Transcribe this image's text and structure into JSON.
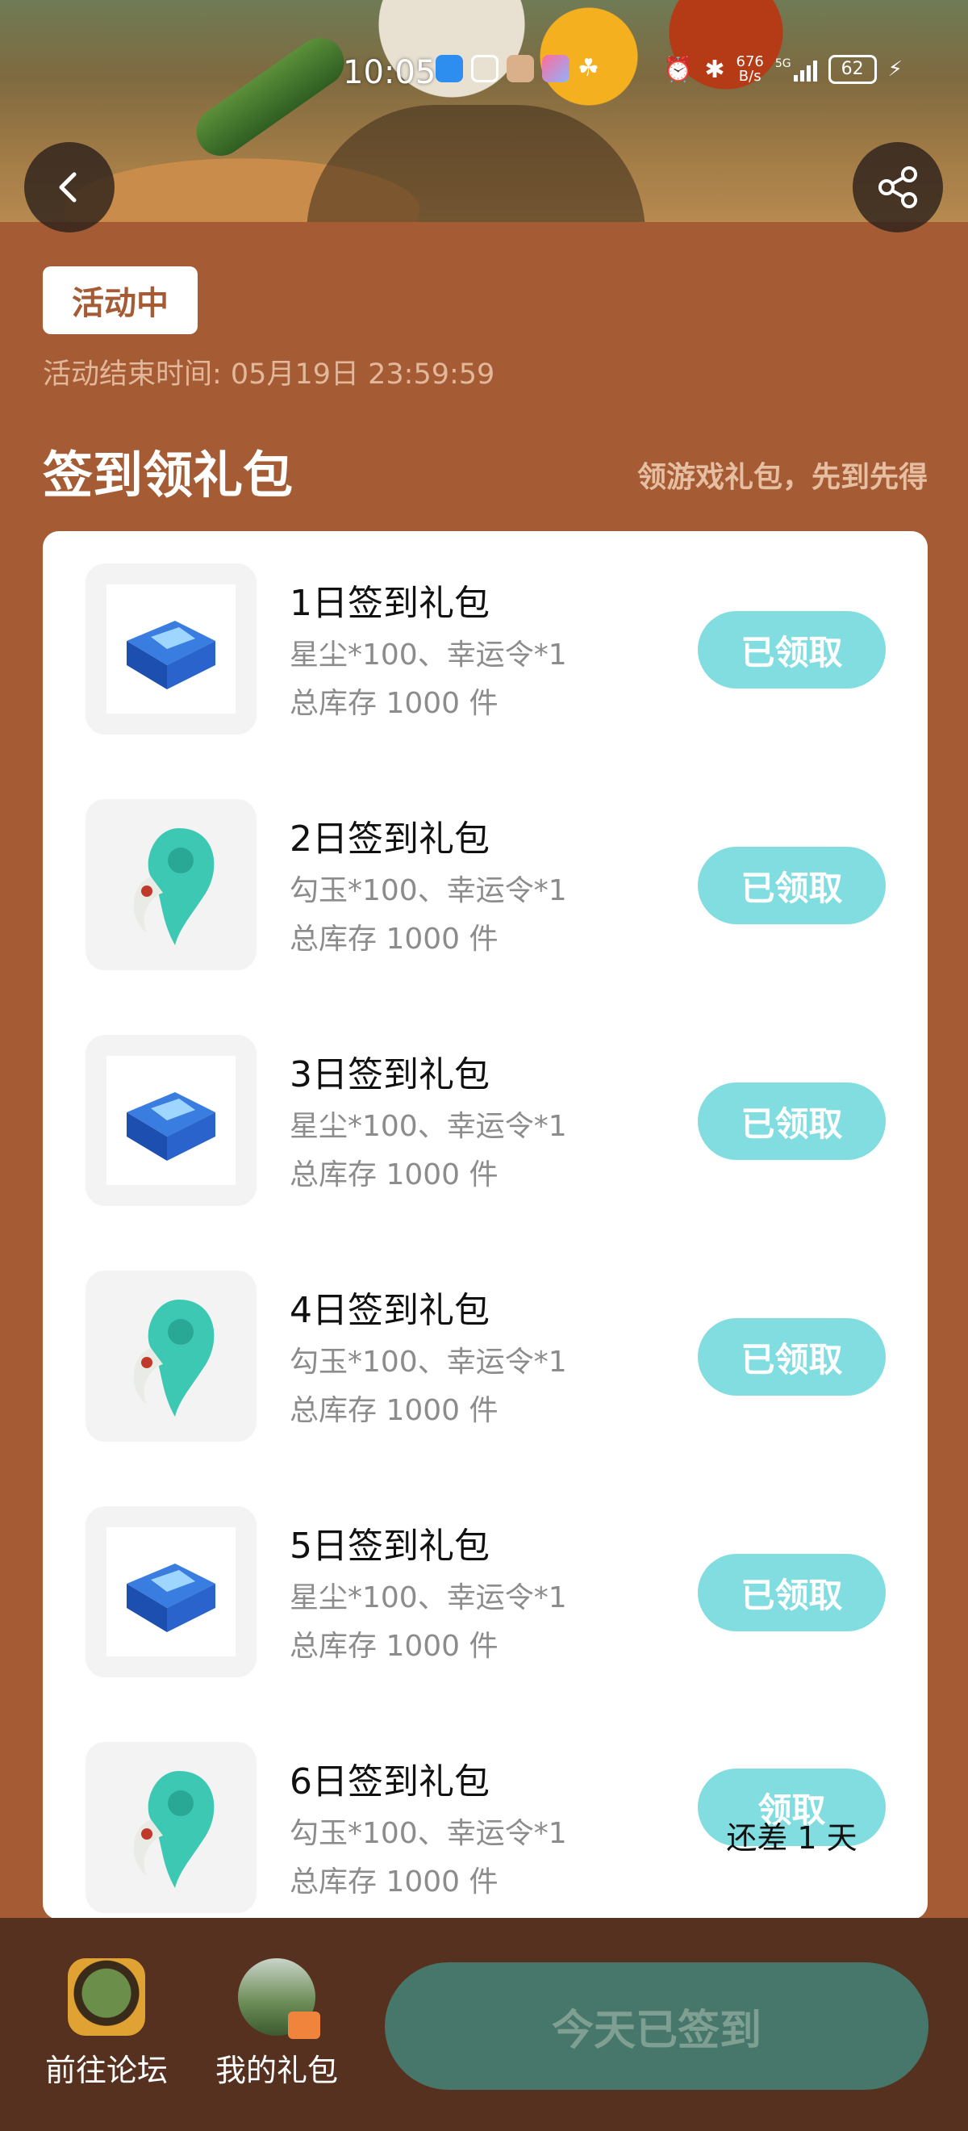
{
  "status_bar": {
    "time": "10:05",
    "net_speed_value": "676",
    "net_speed_unit": "B/s",
    "network": "5G",
    "battery": "62"
  },
  "header": {
    "activity_status": "活动中",
    "end_time": "活动结束时间: 05月19日 23:59:59"
  },
  "section": {
    "title": "签到领礼包",
    "subtitle": "领游戏礼包，先到先得"
  },
  "gifts": [
    {
      "name": "1日签到礼包",
      "desc": "星尘*100、幸运令*1",
      "stock": "总库存 1000 件",
      "button": "已领取",
      "icon": "blue-chest-icon"
    },
    {
      "name": "2日签到礼包",
      "desc": "勾玉*100、幸运令*1",
      "stock": "总库存 1000 件",
      "button": "已领取",
      "icon": "jade-magatama-icon"
    },
    {
      "name": "3日签到礼包",
      "desc": "星尘*100、幸运令*1",
      "stock": "总库存 1000 件",
      "button": "已领取",
      "icon": "blue-chest-icon"
    },
    {
      "name": "4日签到礼包",
      "desc": "勾玉*100、幸运令*1",
      "stock": "总库存 1000 件",
      "button": "已领取",
      "icon": "jade-magatama-icon"
    },
    {
      "name": "5日签到礼包",
      "desc": "星尘*100、幸运令*1",
      "stock": "总库存 1000 件",
      "button": "已领取",
      "icon": "blue-chest-icon"
    },
    {
      "name": "6日签到礼包",
      "desc": "勾玉*100、幸运令*1",
      "stock": "总库存 1000 件",
      "button": "领取",
      "icon": "jade-magatama-icon"
    }
  ],
  "gift6_note": "还差 1 天",
  "bottom": {
    "forum_label": "前往论坛",
    "my_gifts_label": "我的礼包",
    "signed_button": "今天已签到"
  },
  "colors": {
    "page_background": "#a55c35",
    "accent": "#82dde1",
    "bottom_bar": "#56311f",
    "signed_button": "#46776a"
  }
}
